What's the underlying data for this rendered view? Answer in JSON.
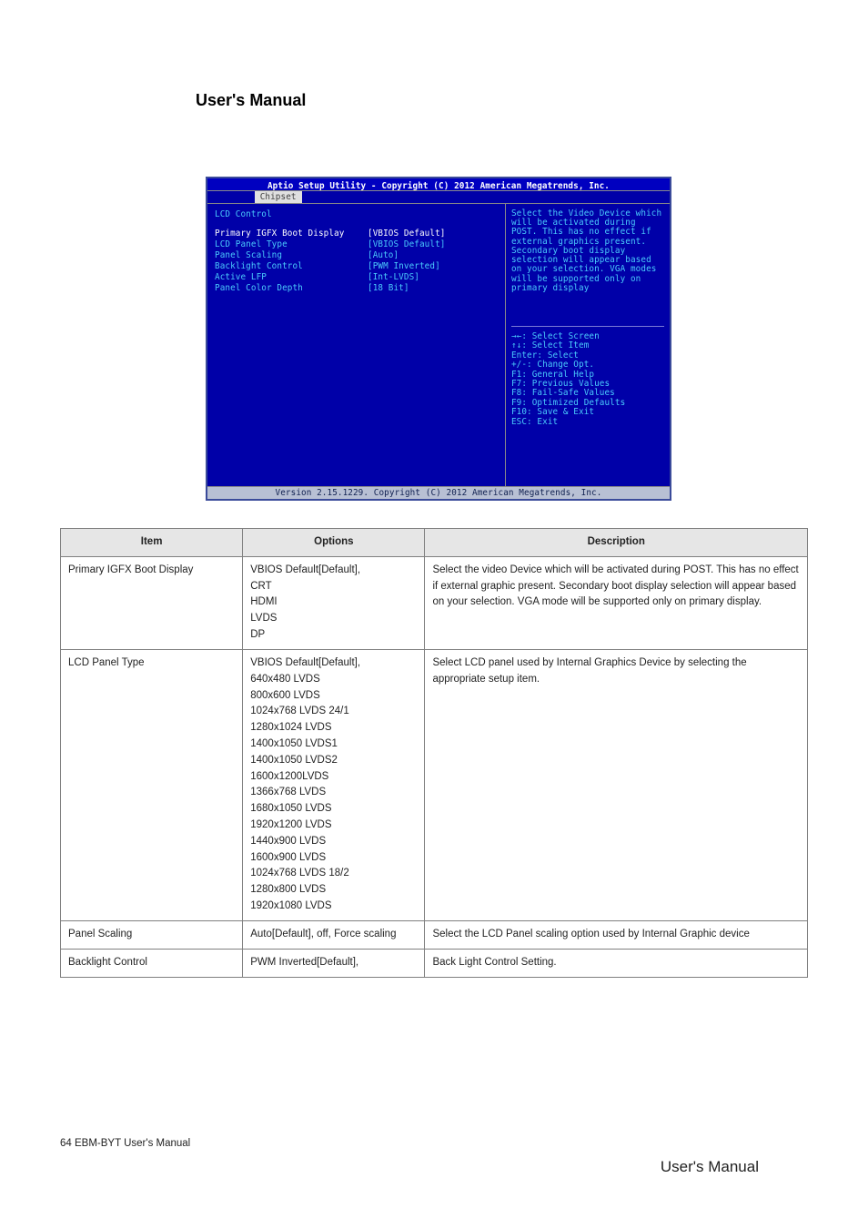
{
  "header": {
    "title": "User's Manual"
  },
  "bios": {
    "titlebar": "Aptio Setup Utility - Copyright (C) 2012 American Megatrends, Inc.",
    "tab": "Chipset",
    "section": "LCD Control",
    "rows": [
      {
        "label": "Primary IGFX Boot Display",
        "value": "[VBIOS Default]",
        "sel": true
      },
      {
        "label": "LCD Panel Type",
        "value": "[VBIOS Default]"
      },
      {
        "label": "Panel Scaling",
        "value": "[Auto]"
      },
      {
        "label": "Backlight Control",
        "value": "[PWM Inverted]"
      },
      {
        "label": "Active LFP",
        "value": "[Int-LVDS]"
      },
      {
        "label": "Panel Color Depth",
        "value": "[18 Bit]"
      }
    ],
    "help": "Select the Video Device which will be activated during POST. This has no effect if external graphics present.\nSecondary boot display selection will appear based on your selection.\nVGA modes will be supported only on primary display",
    "keys": [
      "→←: Select Screen",
      "↑↓: Select Item",
      "Enter: Select",
      "+/-: Change Opt.",
      "F1: General Help",
      "F7: Previous Values",
      "F8: Fail-Safe Values",
      "F9: Optimized Defaults",
      "F10: Save & Exit",
      "ESC: Exit"
    ],
    "footer": "Version 2.15.1229. Copyright (C) 2012 American Megatrends, Inc."
  },
  "table": {
    "headers": [
      "Item",
      "Options",
      "Description"
    ],
    "rows": [
      {
        "item": "Primary IGFX Boot Display",
        "opts": "VBIOS Default[Default],\nCRT\nHDMI\nLVDS\nDP",
        "desc": "Select the video Device which will be activated during POST. This has no effect if external graphic present. Secondary boot display selection will appear based on your selection. VGA mode will be supported only on primary display."
      },
      {
        "item": "LCD Panel Type",
        "opts": "VBIOS Default[Default],\n640x480 LVDS\n800x600 LVDS\n1024x768 LVDS 24/1\n1280x1024 LVDS\n1400x1050 LVDS1\n1400x1050 LVDS2\n1600x1200LVDS\n1366x768 LVDS\n1680x1050 LVDS\n1920x1200 LVDS\n1440x900 LVDS\n1600x900 LVDS\n1024x768 LVDS 18/2\n1280x800 LVDS\n1920x1080 LVDS",
        "desc": "Select LCD panel used by Internal Graphics Device by selecting the appropriate setup item."
      },
      {
        "item": "Panel Scaling",
        "opts": "Auto[Default], off, Force scaling",
        "desc": "Select the LCD Panel scaling option used by Internal Graphic device"
      },
      {
        "item": "Backlight Control",
        "opts": "PWM Inverted[Default],",
        "desc": "Back Light Control Setting."
      }
    ]
  },
  "footer": {
    "page": "64  EBM-BYT User's Manual",
    "manual": "User's Manual"
  }
}
